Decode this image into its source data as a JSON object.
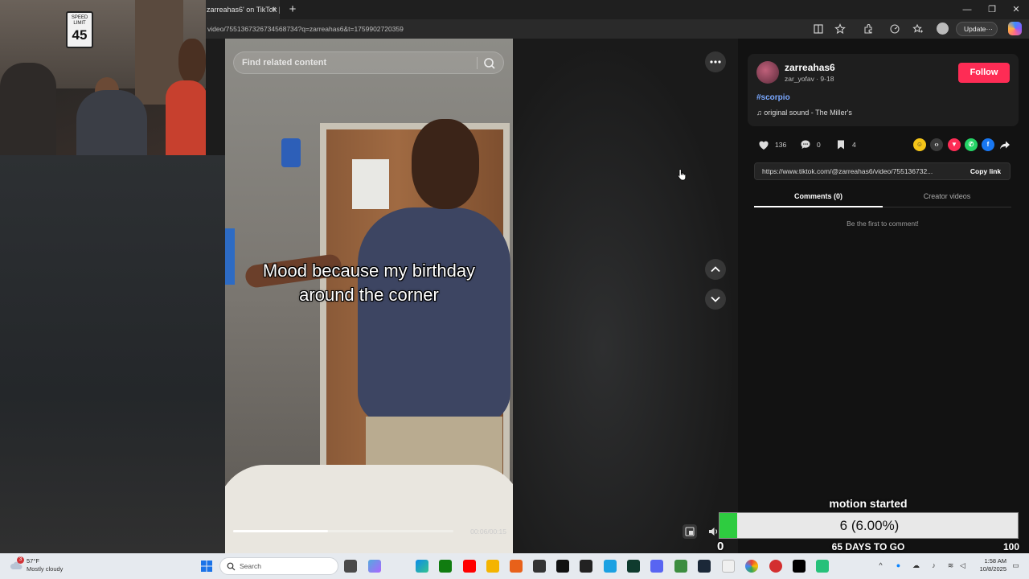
{
  "browser": {
    "tab_title": "zarreahas6' on TikTok |",
    "tab_close": "×",
    "new_tab": "+",
    "url": "video/7551367326734568734?q=zarreahas6&t=1759902720359",
    "update_label": "Update",
    "update_more": "···",
    "window_minimize": "—",
    "window_restore": "❐",
    "window_close": "✕"
  },
  "webcam": {
    "sign_top": "SPEED LIMIT",
    "sign_value": "45"
  },
  "player": {
    "search_placeholder": "Find related content",
    "caption": "Mood because my birthday around the corner",
    "time": "00:06/00:15",
    "progress_fraction": 0.43
  },
  "post": {
    "username": "zarreahas6",
    "subline": "zar_yofav · 9-18",
    "follow_label": "Follow",
    "hashtag": "#scorpio",
    "sound": "original sound - The  Miller's",
    "likes": "136",
    "comments": "0",
    "saves": "4",
    "link": "https://www.tiktok.com/@zarreahas6/video/755136732...",
    "copy_label": "Copy link",
    "tab_comments": "Comments (0)",
    "tab_creator": "Creator videos",
    "empty_comments": "Be the first to comment!"
  },
  "goal": {
    "title": "motion started",
    "value_text": "6 (6.00%)",
    "fraction": 0.06,
    "min": "0",
    "days": "65 DAYS TO GO",
    "max": "100"
  },
  "taskbar": {
    "weather_badge": "3",
    "temp": "57°F",
    "condition": "Mostly cloudy",
    "search_label": "Search",
    "time": "1:58 AM",
    "date": "10/8/2025"
  },
  "colors": {
    "follow": "#fe2c55",
    "hashtag": "#7aa8ff",
    "goal_fill": "#2ecc40"
  }
}
